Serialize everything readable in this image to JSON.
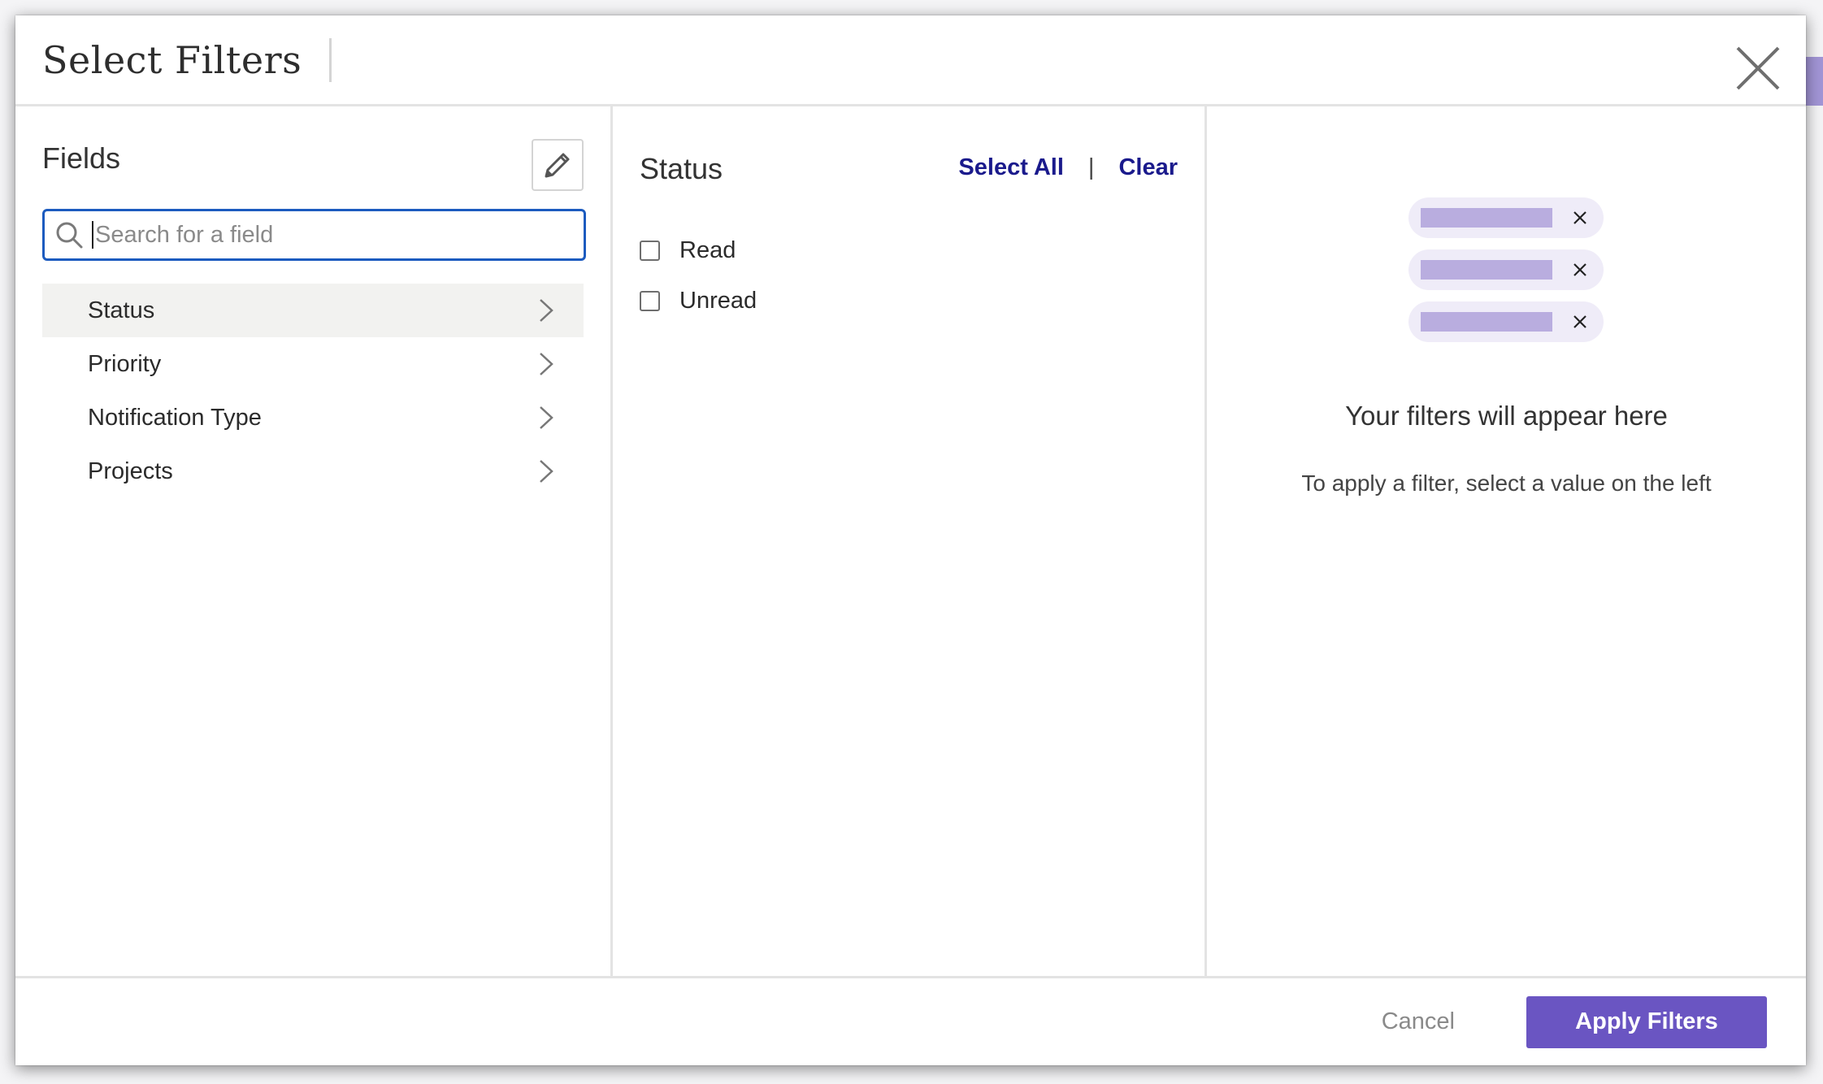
{
  "modal": {
    "title": "Select Filters"
  },
  "fields_panel": {
    "title": "Fields",
    "search_placeholder": "Search for a field",
    "items": [
      {
        "label": "Status",
        "active": true
      },
      {
        "label": "Priority",
        "active": false
      },
      {
        "label": "Notification Type",
        "active": false
      },
      {
        "label": "Projects",
        "active": false
      }
    ]
  },
  "values_panel": {
    "title": "Status",
    "select_all_label": "Select All",
    "separator": "|",
    "clear_label": "Clear",
    "options": [
      {
        "label": "Read",
        "checked": false
      },
      {
        "label": "Unread",
        "checked": false
      }
    ]
  },
  "preview_panel": {
    "empty_title": "Your filters will appear here",
    "empty_subtitle": "To apply a filter, select a value on the left"
  },
  "footer": {
    "cancel_label": "Cancel",
    "apply_label": "Apply Filters"
  },
  "colors": {
    "accent": "#6a55c2",
    "link": "#1a1a8c",
    "search_border": "#1c5bbf",
    "chip_bg": "#efecf8",
    "chip_bar": "#b9addf"
  },
  "icons": {
    "close": "close-icon",
    "edit": "pencil-icon",
    "search": "search-icon",
    "chevron": "chevron-right-icon",
    "chip_remove": "x-icon"
  }
}
